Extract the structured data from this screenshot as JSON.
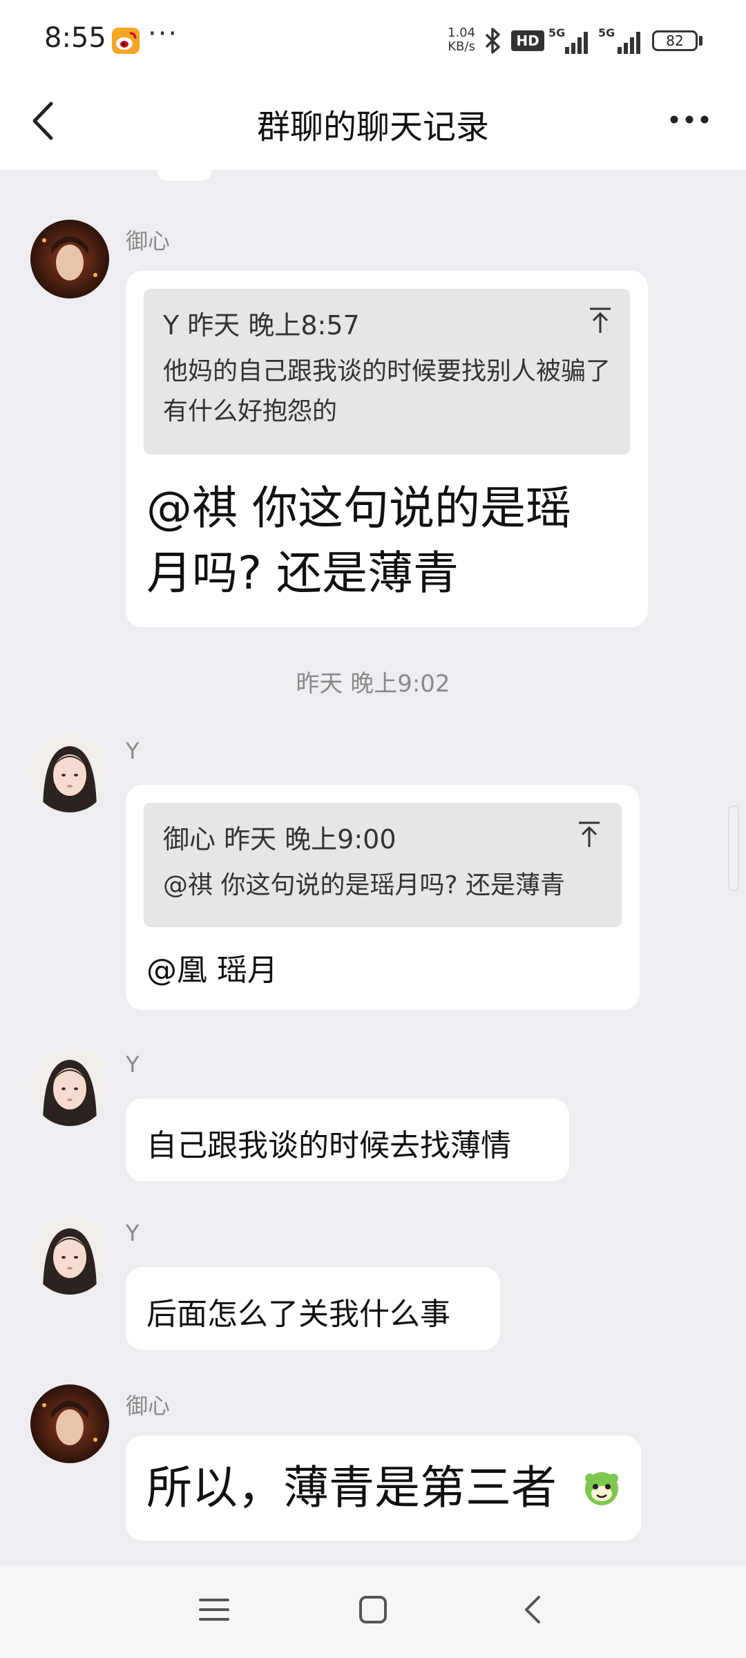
{
  "status_bar": {
    "time": "8:55",
    "more": "···",
    "net_speed_value": "1.04",
    "net_speed_unit": "KB/s",
    "hd_label": "HD",
    "signal1_label": "5G",
    "signal2_label": "5G",
    "battery": "82"
  },
  "header": {
    "title": "群聊的聊天记录"
  },
  "messages": [
    {
      "sender": "御心",
      "quote_head": "Y  昨天  晚上8:57",
      "quote_text": "他妈的自己跟我谈的时候要找别人被骗了有什么好抱怨的",
      "text_line1": "@祺 你这句说的是瑶",
      "text_line2": "月吗? 还是薄青"
    },
    {
      "timestamp": "昨天  晚上9:02"
    },
    {
      "sender": "Y",
      "quote_head": "御心  昨天  晚上9:00",
      "quote_text": "@祺 你这句说的是瑶月吗? 还是薄青",
      "text": "@凰 瑶月"
    },
    {
      "sender": "Y",
      "text": "自己跟我谈的时候去找薄情"
    },
    {
      "sender": "Y",
      "text": "后面怎么了关我什么事"
    },
    {
      "sender": "御心",
      "text": "所以，薄青是第三者"
    }
  ],
  "icons": {
    "back": "chevron-left-icon",
    "more": "more-dots-icon",
    "pin": "scroll-to-top-icon",
    "emoji": "green-dinosaur-emoji",
    "nav_menu": "menu-icon",
    "nav_home": "home-square-icon",
    "nav_back": "back-triangle-icon"
  },
  "colors": {
    "background": "#ededf2",
    "bubble": "#ffffff",
    "quote_bg": "#e6e6e6",
    "meta_text": "#8a8a8a"
  }
}
